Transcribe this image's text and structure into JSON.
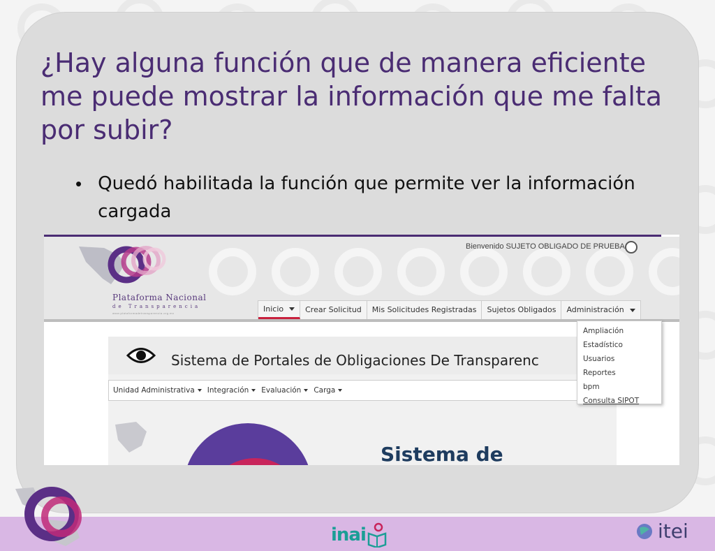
{
  "slide": {
    "title": "¿Hay alguna función que de manera eficiente me puede mostrar la información que me falta por subir?",
    "bullet": "Quedó habilitada la función que permite ver la información cargada"
  },
  "screenshot": {
    "logo": {
      "name": "Plataforma Nacional",
      "subtitle": "de Transparencia",
      "url": "www.plataformadetransparencia.org.mx"
    },
    "welcome": "Bienvenido SUJETO OBLIGADO DE PRUEBA",
    "nav": [
      {
        "label": "Inicio",
        "dropdown": true,
        "active": true
      },
      {
        "label": "Crear Solicitud",
        "dropdown": false
      },
      {
        "label": "Mis Solicitudes Registradas",
        "dropdown": false
      },
      {
        "label": "Sujetos Obligados",
        "dropdown": false
      },
      {
        "label": "Administración",
        "dropdown": true
      }
    ],
    "dropdown_items": [
      "Ampliación",
      "Estadístico",
      "Usuarios",
      "Reportes",
      "bpm",
      "Consulta SIPOT"
    ],
    "content_title": "Sistema de Portales de Obligaciones De Transparenc",
    "subnav": [
      "Unidad Administrativa",
      "Integración",
      "Evaluación",
      "Carga"
    ],
    "hero_text": "Sistema de"
  },
  "footer": {
    "inai_label": "inai",
    "itei_label": "itei"
  },
  "colors": {
    "title": "#4a2c73",
    "footer_bg": "#d9b7e4",
    "inai": "#1b9e96",
    "active_tab": "#c8203d"
  }
}
